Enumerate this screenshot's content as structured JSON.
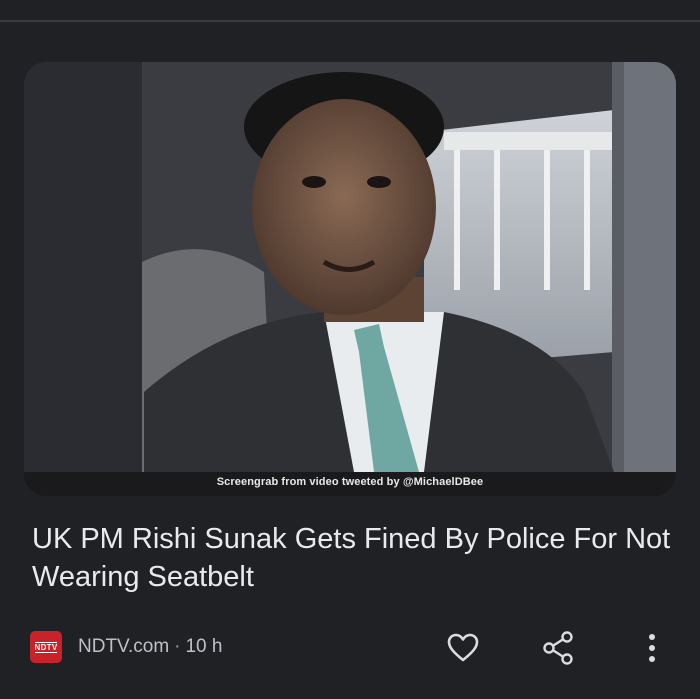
{
  "article": {
    "image_caption": "Screengrab from video tweeted by @MichaelDBee",
    "headline": "UK PM Rishi Sunak Gets Fined By Police For Not Wearing Seatbelt"
  },
  "source": {
    "logo_text": "NDTV",
    "name": "NDTV.com",
    "separator": "·",
    "time": "10 h"
  },
  "actions": {
    "like_icon": "heart-outline-icon",
    "share_icon": "share-icon",
    "more_icon": "more-vertical-icon"
  },
  "colors": {
    "background": "#202124",
    "text_primary": "#e8eaed",
    "text_secondary": "#bdc1c6",
    "logo_red": "#c8222b"
  }
}
